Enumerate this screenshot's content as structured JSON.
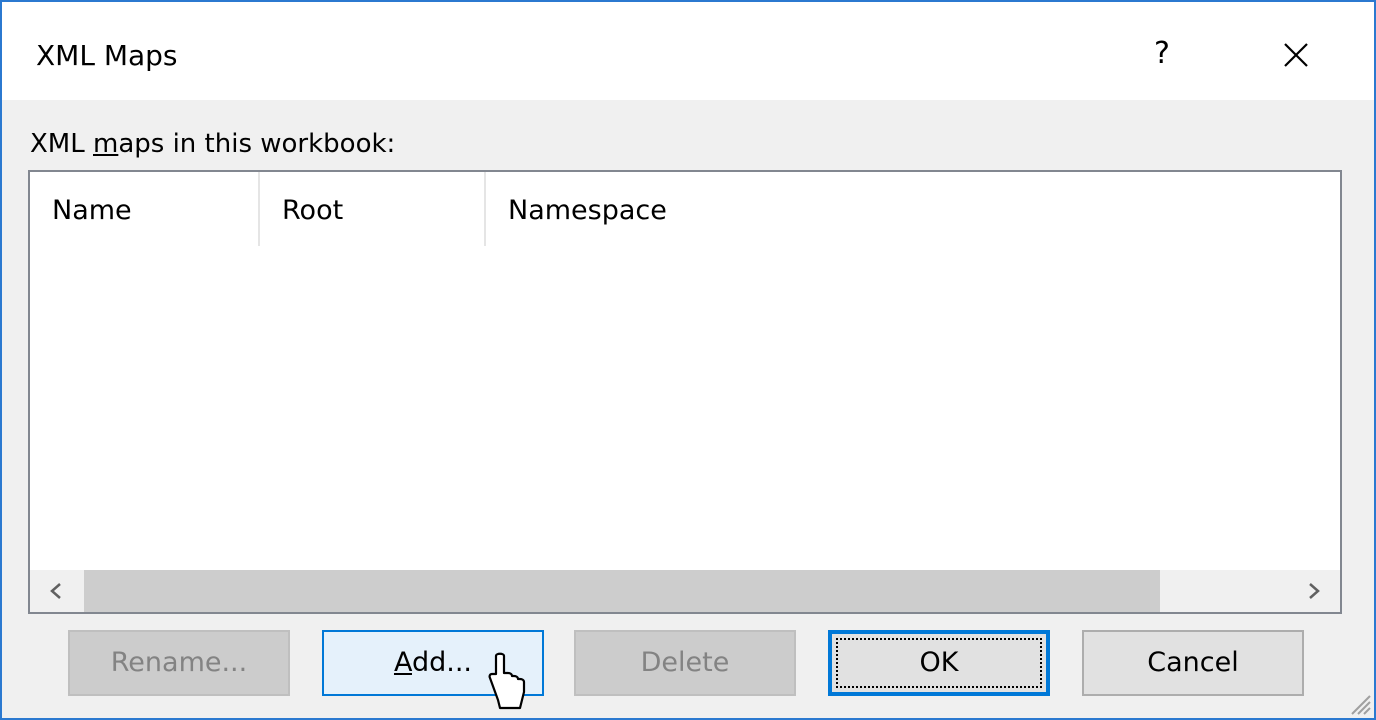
{
  "window": {
    "title": "XML Maps",
    "help_label": "?",
    "close_icon": "close-icon"
  },
  "section_label": {
    "prefix": "XML ",
    "mnemonic": "m",
    "suffix": "aps in this workbook:"
  },
  "maps_table": {
    "columns": [
      "Name",
      "Root",
      "Namespace"
    ],
    "rows": []
  },
  "scrollbar": {
    "left_arrow": "<",
    "right_arrow": ">"
  },
  "buttons": {
    "rename": {
      "label": "Rename...",
      "enabled": false
    },
    "add": {
      "mnemonic": "A",
      "rest": "dd...",
      "enabled": true,
      "hovered": true
    },
    "delete": {
      "label": "Delete",
      "enabled": false
    },
    "ok": {
      "label": "OK",
      "enabled": true,
      "default": true
    },
    "cancel": {
      "label": "Cancel",
      "enabled": true
    }
  },
  "colors": {
    "window_border": "#2b79d0",
    "accent": "#0078d7",
    "dialog_bg": "#f0f0f0"
  }
}
